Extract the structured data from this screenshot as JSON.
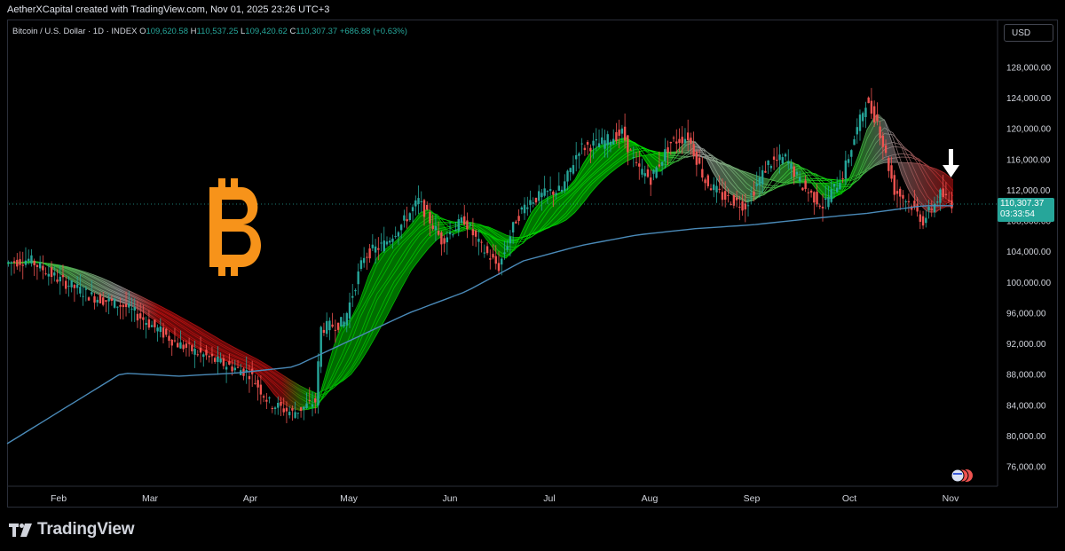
{
  "header": {
    "attribution": "AetherXCapital created with TradingView.com, Nov 01, 2025 23:26 UTC+3"
  },
  "legend": {
    "symbol": "Bitcoin / U.S. Dollar · 1D · INDEX",
    "o_label": "O",
    "o_value": "109,620.58",
    "h_label": "H",
    "h_value": "110,537.25",
    "l_label": "L",
    "l_value": "109,420.62",
    "c_label": "C",
    "c_value": "110,307.37",
    "change": "+686.88 (+0.63%)"
  },
  "currency": "USD",
  "price_tag": {
    "price": "110,307.37",
    "countdown": "03:33:54"
  },
  "brand": {
    "name": "TradingView"
  },
  "colors": {
    "up": "#26a69a",
    "down": "#ef5350",
    "ma": "#4a8ab8",
    "ribbon_up": "#00e600",
    "ribbon_down": "#d01010",
    "bitcoin": "#f7931a"
  },
  "chart_data": {
    "type": "line",
    "title": "Bitcoin / U.S. Dollar · 1D · INDEX",
    "xlabel": "",
    "ylabel": "",
    "y_ticks": [
      "128,000.00",
      "124,000.00",
      "120,000.00",
      "116,000.00",
      "112,000.00",
      "108,000.00",
      "104,000.00",
      "100,000.00",
      "96,000.00",
      "92,000.00",
      "88,000.00",
      "84,000.00",
      "80,000.00",
      "76,000.00"
    ],
    "x_ticks": [
      "Feb",
      "Mar",
      "Apr",
      "May",
      "Jun",
      "Jul",
      "Aug",
      "Sep",
      "Oct",
      "Nov"
    ],
    "ylim": [
      74000,
      131000
    ],
    "grid": false,
    "series": [
      {
        "values": [
          [
            0,
            102500
          ],
          [
            8,
            103000
          ],
          [
            18,
            100500
          ],
          [
            30,
            98200
          ],
          [
            42,
            96800
          ],
          [
            60,
            92000
          ],
          [
            75,
            89500
          ],
          [
            85,
            88200
          ],
          [
            92,
            84300
          ],
          [
            100,
            83000
          ],
          [
            108,
            84500
          ],
          [
            110,
            94000
          ],
          [
            118,
            94800
          ],
          [
            125,
            103500
          ],
          [
            132,
            105000
          ],
          [
            138,
            107500
          ],
          [
            144,
            110600
          ],
          [
            152,
            105500
          ],
          [
            160,
            108200
          ],
          [
            165,
            105000
          ],
          [
            172,
            102000
          ],
          [
            178,
            108200
          ],
          [
            182,
            110500
          ],
          [
            190,
            111800
          ],
          [
            194,
            112000
          ],
          [
            200,
            117500
          ],
          [
            208,
            118200
          ],
          [
            215,
            119500
          ],
          [
            220,
            115000
          ],
          [
            225,
            113500
          ],
          [
            232,
            118200
          ],
          [
            238,
            119000
          ],
          [
            244,
            113200
          ],
          [
            250,
            111200
          ],
          [
            258,
            110000
          ],
          [
            266,
            115500
          ],
          [
            272,
            116200
          ],
          [
            278,
            112500
          ],
          [
            285,
            110000
          ],
          [
            292,
            114000
          ],
          [
            300,
            123500
          ],
          [
            304,
            121000
          ],
          [
            310,
            112000
          ],
          [
            315,
            110500
          ],
          [
            320,
            108000
          ],
          [
            326,
            111500
          ],
          [
            330,
            110300
          ]
        ]
      },
      {
        "values": [
          [
            0,
            79000
          ],
          [
            40,
            88200
          ],
          [
            60,
            87800
          ],
          [
            80,
            88200
          ],
          [
            100,
            89000
          ],
          [
            120,
            92500
          ],
          [
            140,
            96000
          ],
          [
            160,
            98800
          ],
          [
            180,
            102800
          ],
          [
            200,
            104800
          ],
          [
            220,
            106200
          ],
          [
            240,
            107000
          ],
          [
            260,
            107500
          ],
          [
            280,
            108300
          ],
          [
            300,
            109000
          ],
          [
            320,
            110000
          ],
          [
            330,
            110000
          ]
        ]
      }
    ]
  }
}
